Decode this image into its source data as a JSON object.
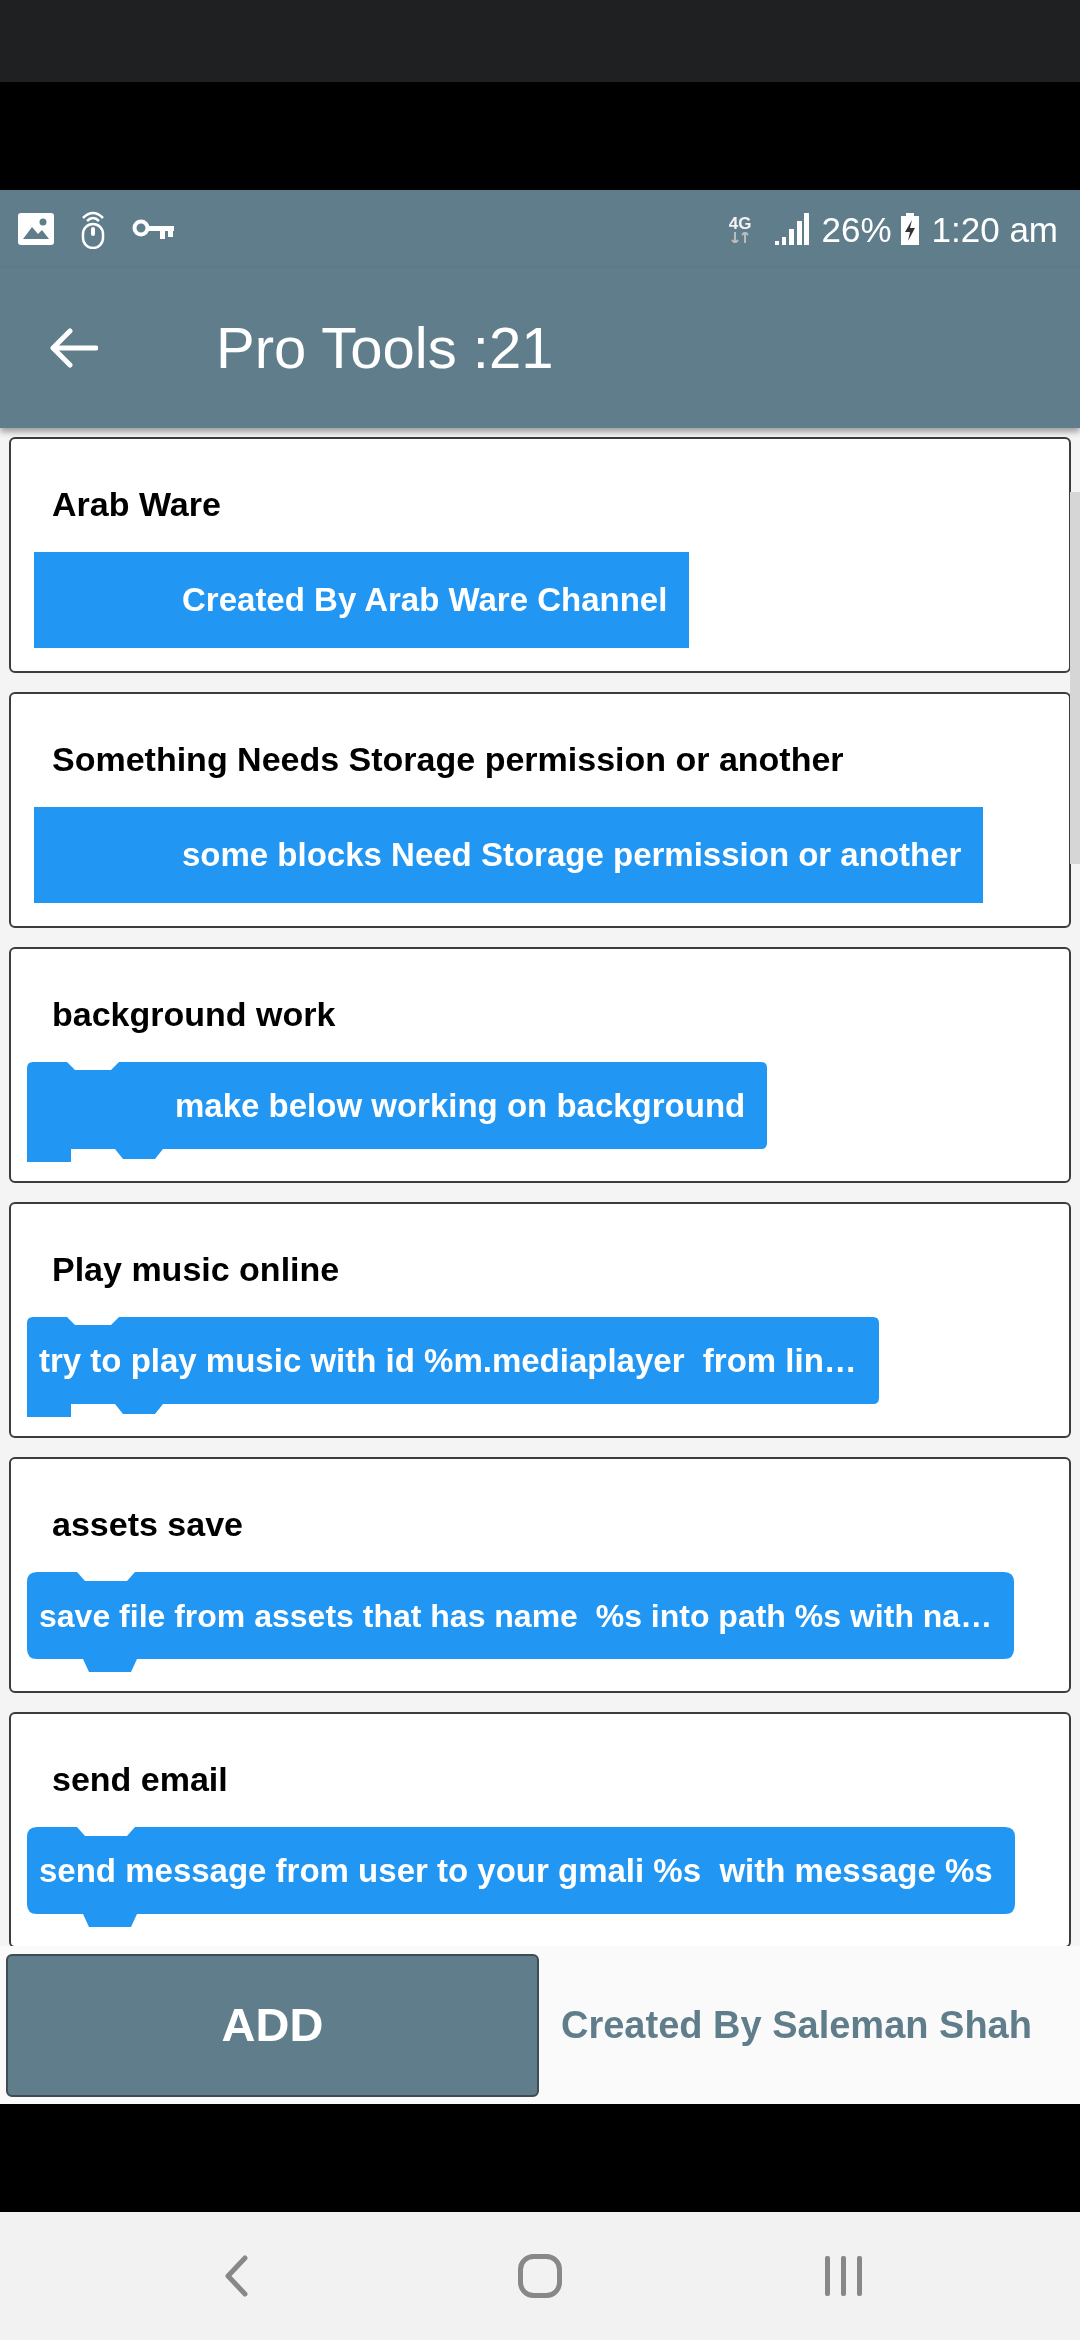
{
  "status_bar": {
    "network": "4G",
    "battery": "26%",
    "time": "1:20 am"
  },
  "app_bar": {
    "title": "Pro Tools :21"
  },
  "items": [
    {
      "title": "Arab Ware",
      "block": "Created By Arab Ware Channel",
      "kind": "plain"
    },
    {
      "title": "Something Needs Storage permission or another",
      "block": "some blocks Need Storage permission or another",
      "kind": "plain"
    },
    {
      "title": "background work",
      "block": "make below working on background",
      "kind": "bracket"
    },
    {
      "title": "Play music online",
      "block": "try to play music with id %m.mediaplayer  from lin…",
      "kind": "bracket"
    },
    {
      "title": "assets save",
      "block": "save file from assets that has name  %s into path %s with na…",
      "kind": "statement"
    },
    {
      "title": "send email",
      "block": "send message from user to your gmali %s  with message %s",
      "kind": "statement"
    }
  ],
  "footer": {
    "button": "ADD",
    "credit": "Created By Saleman Shah"
  }
}
